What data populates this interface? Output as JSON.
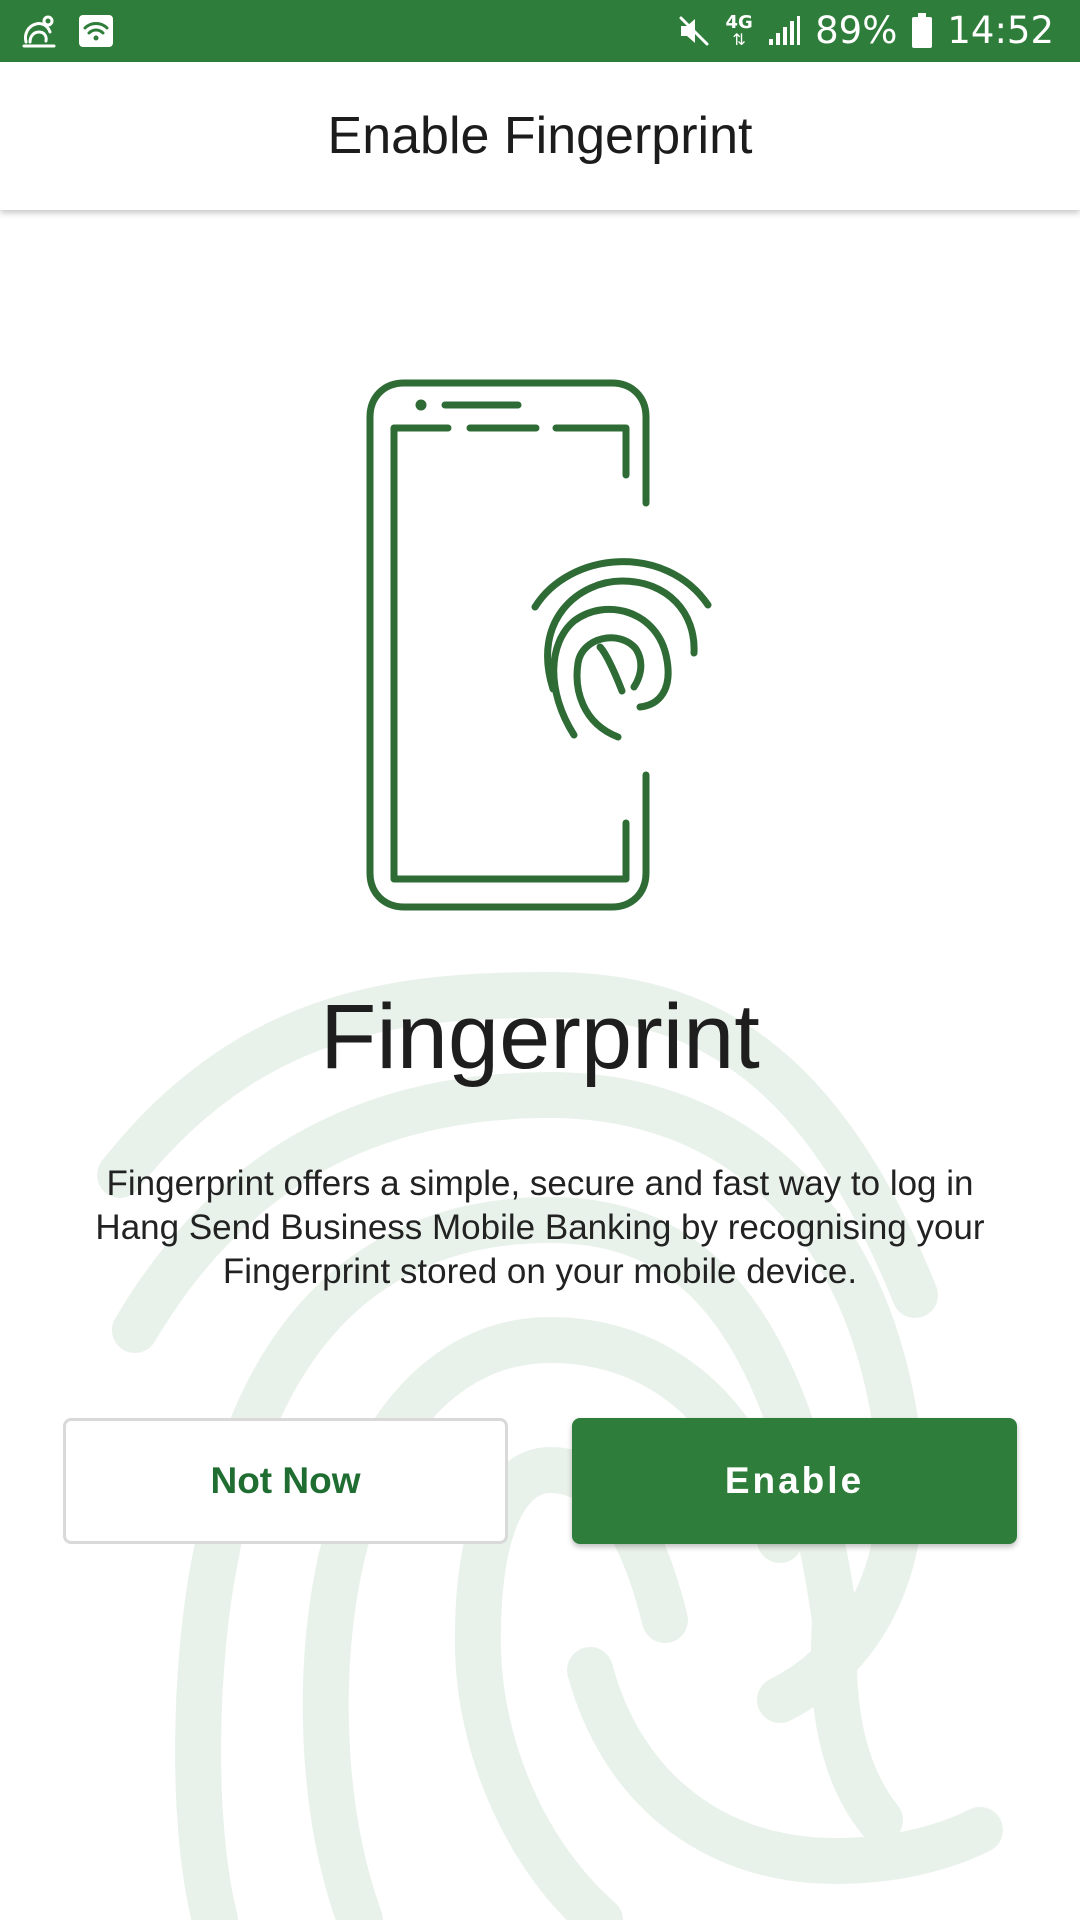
{
  "status_bar": {
    "left_icons": [
      "uc-browser-icon",
      "wifi-icon"
    ],
    "right_icons": [
      "mute-icon",
      "network-4g-icon",
      "signal-icon",
      "battery-icon"
    ],
    "network_label": "4G",
    "battery_percent": "89%",
    "time": "14:52",
    "background_color": "#2e7d3a"
  },
  "header": {
    "title": "Enable Fingerprint"
  },
  "illustration": {
    "icon": "phone-fingerprint-icon",
    "color": "#2e6b35"
  },
  "content": {
    "title": "Fingerprint",
    "description": "Fingerprint offers a simple, secure and fast way to log in Hang Send Business Mobile Banking by recognising your Fingerprint stored on your mobile device."
  },
  "actions": {
    "not_now_label": "Not Now",
    "enable_label": "Enable"
  },
  "colors": {
    "primary": "#2e7d3a",
    "primary_text": "#1f6d31",
    "watermark": "#e9f2ea"
  }
}
